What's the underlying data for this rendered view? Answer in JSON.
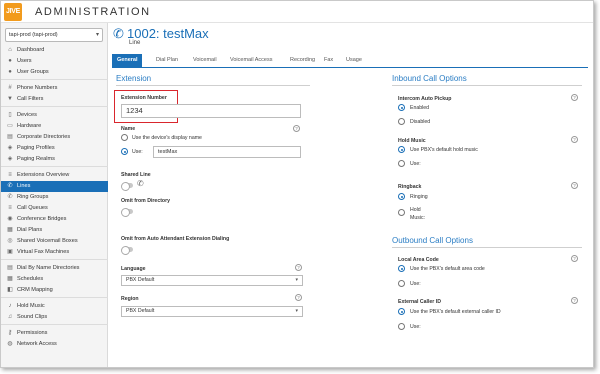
{
  "app": {
    "logo": "JIVE",
    "title": "ADMINISTRATION"
  },
  "sidebar": {
    "pbx_selector": "tapi-prod (tapi-prod)",
    "items": [
      {
        "label": "Dashboard",
        "icon": "dashboard-icon",
        "glyph": "⌂"
      },
      {
        "label": "Users",
        "icon": "user-icon",
        "glyph": "●"
      },
      {
        "label": "User Groups",
        "icon": "user-group-icon",
        "glyph": "●"
      },
      {
        "label": "Phone Numbers",
        "icon": "hash-icon",
        "glyph": "#"
      },
      {
        "label": "Call Filters",
        "icon": "filter-icon",
        "glyph": "▼"
      },
      {
        "label": "Devices",
        "icon": "device-icon",
        "glyph": "▯"
      },
      {
        "label": "Hardware",
        "icon": "hardware-icon",
        "glyph": "▭"
      },
      {
        "label": "Corporate Directories",
        "icon": "directory-icon",
        "glyph": "▤"
      },
      {
        "label": "Paging Profiles",
        "icon": "paging-profile-icon",
        "glyph": "◈"
      },
      {
        "label": "Paging Realms",
        "icon": "paging-realm-icon",
        "glyph": "◈"
      },
      {
        "label": "Extensions Overview",
        "icon": "extensions-icon",
        "glyph": "≡"
      },
      {
        "label": "Lines",
        "icon": "phone-icon",
        "glyph": "✆"
      },
      {
        "label": "Ring Groups",
        "icon": "ring-group-icon",
        "glyph": "✆"
      },
      {
        "label": "Call Queues",
        "icon": "queue-icon",
        "glyph": "≡"
      },
      {
        "label": "Conference Bridges",
        "icon": "conference-icon",
        "glyph": "◉"
      },
      {
        "label": "Dial Plans",
        "icon": "dial-plan-icon",
        "glyph": "▦"
      },
      {
        "label": "Shared Voicemail Boxes",
        "icon": "voicemail-icon",
        "glyph": "◎"
      },
      {
        "label": "Virtual Fax Machines",
        "icon": "fax-icon",
        "glyph": "▣"
      },
      {
        "label": "Dial By Name Directories",
        "icon": "name-directory-icon",
        "glyph": "▤"
      },
      {
        "label": "Schedules",
        "icon": "calendar-icon",
        "glyph": "▦"
      },
      {
        "label": "CRM Mapping",
        "icon": "crm-icon",
        "glyph": "◧"
      },
      {
        "label": "Hold Music",
        "icon": "music-icon",
        "glyph": "♪"
      },
      {
        "label": "Sound Clips",
        "icon": "sound-icon",
        "glyph": "♫"
      },
      {
        "label": "Permissions",
        "icon": "key-icon",
        "glyph": "⚷"
      },
      {
        "label": "Network Access",
        "icon": "network-icon",
        "glyph": "◍"
      }
    ],
    "active_index": 11
  },
  "page": {
    "title": "1002: testMax",
    "subtitle": "Line",
    "tabs": [
      "General",
      "Dial Plan",
      "Voicemail",
      "Voicemail Access",
      "Recording",
      "Fax",
      "Usage"
    ],
    "active_tab": 0
  },
  "extension": {
    "section_title": "Extension",
    "ext_number_label": "Extension Number",
    "ext_number_value": "1234",
    "name_label": "Name",
    "name_opt1": "Use the device's display name",
    "name_opt2": "Use:",
    "name_value": "testMax",
    "shared_line_label": "Shared Line",
    "omit_dir_label": "Omit from Directory",
    "omit_aa_label": "Omit from Auto Attendant Extension Dialing",
    "language_label": "Language",
    "language_value": "PBX Default",
    "region_label": "Region",
    "region_value": "PBX Default"
  },
  "inbound": {
    "section_title": "Inbound Call Options",
    "intercom_label": "Intercom Auto Pickup",
    "intercom_opt1": "Enabled",
    "intercom_opt2": "Disabled",
    "hold_label": "Hold Music",
    "hold_opt1": "Use PBX's default hold music",
    "hold_opt2": "Use:",
    "ringback_label": "Ringback",
    "ringback_opt1": "Ringing",
    "ringback_opt2a": "Hold",
    "ringback_opt2b": "Music:"
  },
  "outbound": {
    "section_title": "Outbound Call Options",
    "area_label": "Local Area Code",
    "area_opt1": "Use the PBX's default area code",
    "area_opt2": "Use:",
    "caller_label": "External Caller ID",
    "caller_opt1": "Use the PBX's default external caller ID",
    "caller_opt2": "Use:"
  },
  "colors": {
    "accent": "#1a6fb7",
    "highlight": "#d9262d",
    "logo": "#f29b1d"
  }
}
